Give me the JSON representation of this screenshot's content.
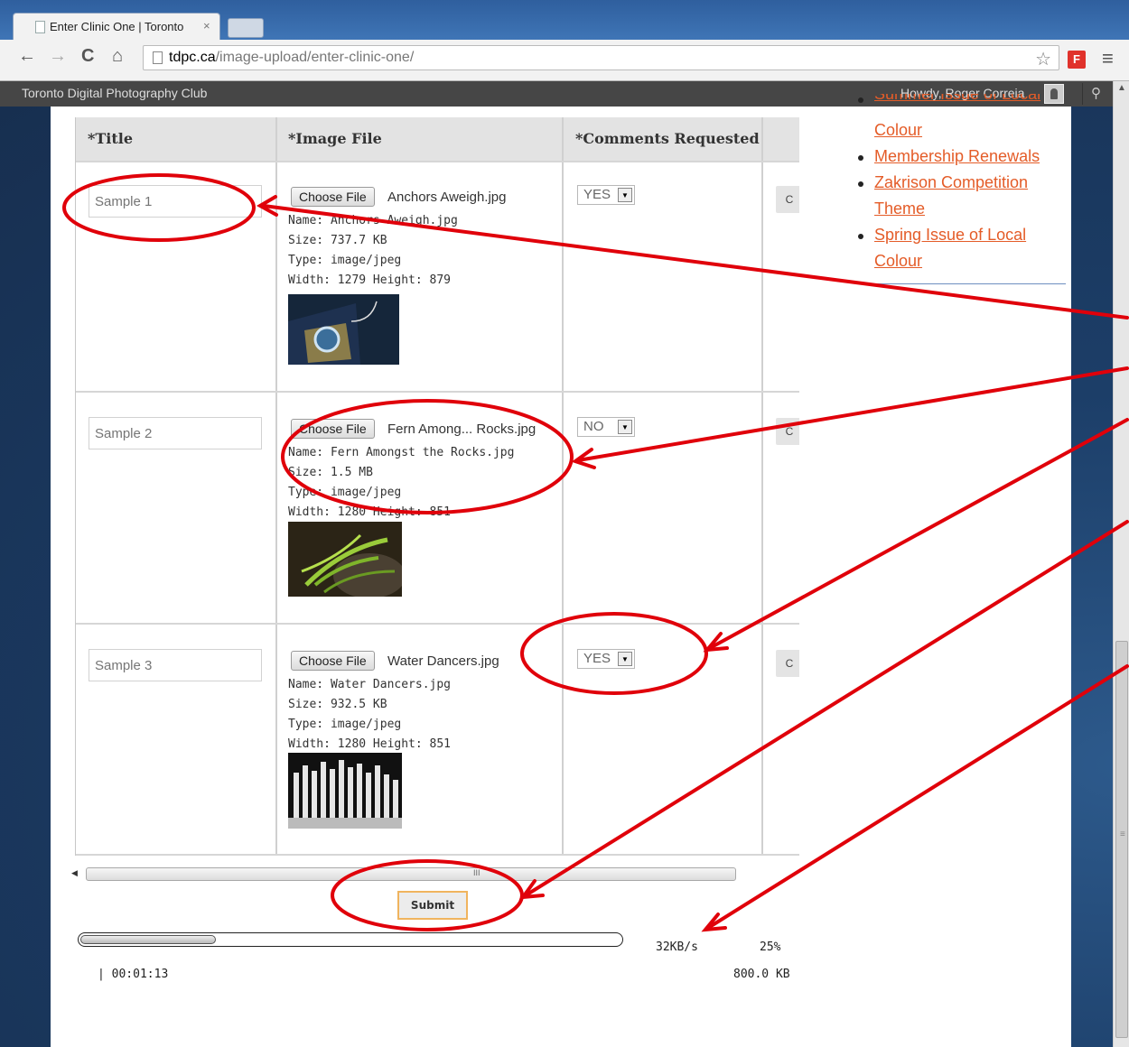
{
  "browser": {
    "tab_title": "Enter Clinic One | Toronto",
    "tab_close": "×",
    "url_host": "tdpc.ca",
    "url_path": "/image-upload/enter-clinic-one/",
    "back_icon": "←",
    "forward_icon": "→",
    "reload_icon": "C",
    "home_icon": "⌂",
    "star_icon": "☆",
    "menu_icon": "≡",
    "extension_label": "F",
    "extension_color": "#e0322b"
  },
  "adminbar": {
    "site_name": "Toronto Digital Photography Club",
    "howdy": "Howdy, Roger Correia",
    "search_icon": "🔍"
  },
  "table": {
    "headers": [
      "*Title",
      "*Image File",
      "*Comments Requested"
    ],
    "choose_file_label": "Choose File",
    "rows": [
      {
        "title_placeholder": "Sample 1",
        "file_label": "Anchors Aweigh.jpg",
        "meta": [
          "Name: Anchors Aweigh.jpg",
          "Size: 737.7 KB",
          "Type: image/jpeg",
          "Width: 1279 Height: 879"
        ],
        "comments": "YES",
        "extra_button": "C"
      },
      {
        "title_placeholder": "Sample 2",
        "file_label": "Fern Among... Rocks.jpg",
        "meta": [
          "Name: Fern Amongst the Rocks.jpg",
          "Size: 1.5 MB",
          "Type: image/jpeg",
          "Width: 1280 Height: 851"
        ],
        "comments": "NO",
        "extra_button": "C"
      },
      {
        "title_placeholder": "Sample 3",
        "file_label": "Water Dancers.jpg",
        "meta": [
          "Name: Water Dancers.jpg",
          "Size: 932.5 KB",
          "Type: image/jpeg",
          "Width: 1280 Height: 851"
        ],
        "comments": "YES",
        "extra_button": "C"
      }
    ]
  },
  "hscroll_grip": "III",
  "submit_label": "Submit",
  "progress": {
    "fraction": 0.25,
    "speed": "32KB/s",
    "percent": "25%",
    "elapsed": "| 00:01:13",
    "total": "800.0 KB"
  },
  "sidebar": {
    "partial_item": "Summer Issue of Local",
    "items": [
      {
        "lines": [
          "Colour"
        ],
        "bullet": false
      },
      {
        "lines": [
          "Membership Renewals"
        ],
        "bullet": true
      },
      {
        "lines": [
          "Zakrison Competition",
          "Theme"
        ],
        "bullet": true
      },
      {
        "lines": [
          "Spring Issue of Local",
          "Colour"
        ],
        "bullet": true
      }
    ]
  },
  "annotation_color": "#e0000a"
}
